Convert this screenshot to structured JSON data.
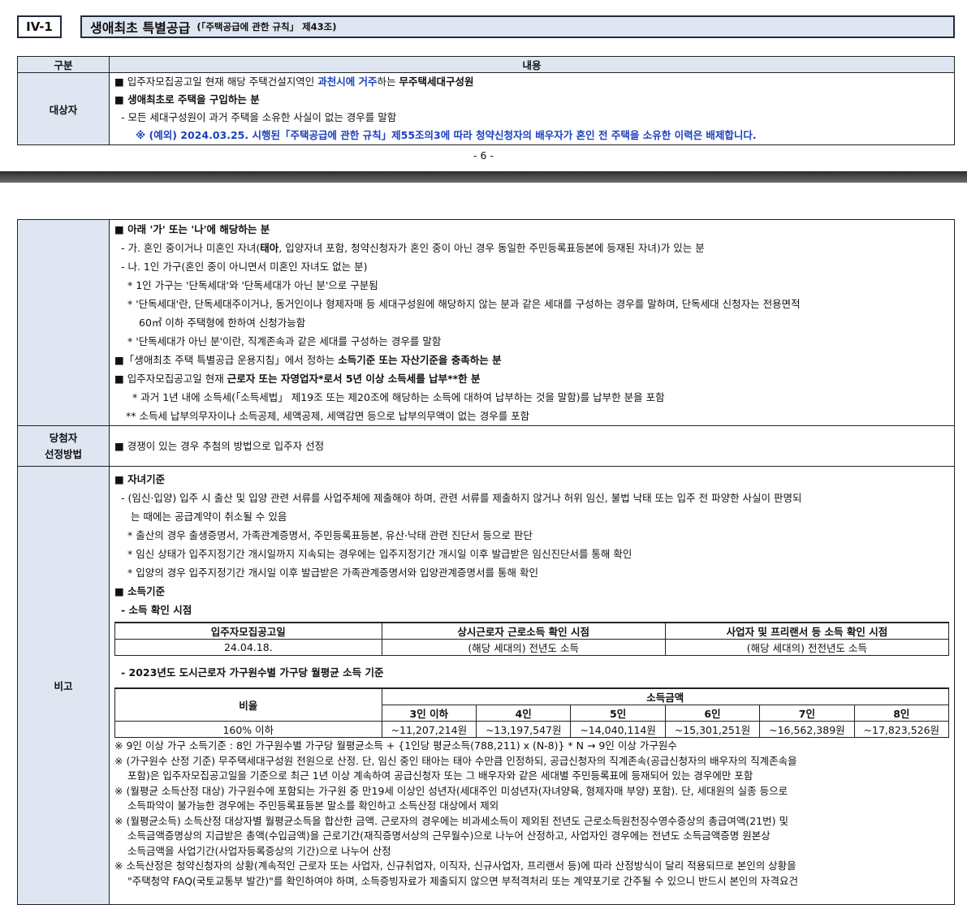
{
  "section": {
    "number": "IV-1",
    "title": "생애최초 특별공급",
    "subtitle": "(「주택공급에 관한 규칙」 제43조)"
  },
  "top_table": {
    "col_category": "구분",
    "col_content": "내용",
    "target_label": "대상자",
    "line1_a": "■ 입주자모집공고일 현재 해당 주택건설지역인 ",
    "line1_b": "과천시에 거주",
    "line1_c": "하는 ",
    "line1_d": "무주택세대구성원",
    "line2": "■ 생애최초로 주택을 구입하는 분",
    "line3": "- 모든 세대구성원이 과거 주택을 소유한 사실이 없는 경우를 말함",
    "line4": "※ (예외) 2024.03.25. 시행된「주택공급에 관한 규칙」제55조의3에 따라 청약신청자의 배우자가 혼인 전 주택을 소유한 이력은 배제합니다."
  },
  "page_number_6": "- 6 -",
  "cont": {
    "b1": "■ 아래 '가' 또는 '나'에 해당하는 분",
    "b1_ga_a": "- 가. 혼인 중이거나 미혼인 자녀(",
    "b1_ga_b": "태아",
    "b1_ga_c": ", 입양자녀 포함, 청약신청자가 혼인 중이 아닌 경우 동일한 주민등록표등본에 등재된 자녀)가 있는 분",
    "b1_na": "- 나. 1인 가구(혼인 중이 아니면서 미혼인 자녀도 없는 분)",
    "b1_s1": "* 1인 가구는 '단독세대'와 '단독세대가 아닌 분'으로 구분됨",
    "b1_s2": "* '단독세대'란, 단독세대주이거나, 동거인이나 형제자매 등 세대구성원에 해당하지 않는 분과 같은 세대를 구성하는 경우를 말하며, 단독세대 신청자는 전용면적",
    "b1_s2b": "60㎡ 이하 주택형에 한하여 신청가능함",
    "b1_s3": "* '단독세대가 아닌 분'이란, 직계존속과 같은 세대를 구성하는 경우를 말함",
    "b2_a": "■「생애최초 주택 특별공급 운용지침」에서 정하는 ",
    "b2_b": "소득기준 또는 자산기준을 충족하는 분",
    "b3_a": "■ 입주자모집공고일 현재 ",
    "b3_b": "근로자 또는 자영업자*로서 5년 이상 소득세를 납부**한 분",
    "b3_s1": "* 과거 1년 내에 소득세(「소득세법」 제19조 또는 제20조에 해당하는 소득에 대하여 납부하는 것을 말함)를 납부한 분을 포함",
    "b3_s2": "** 소득세 납부의무자이나 소득공제, 세액공제, 세액감면 등으로 납부의무액이 없는 경우를 포함"
  },
  "selection": {
    "label_1": "당첨자",
    "label_2": "선정방법",
    "text": "■ 경쟁이 있는 경우 추첨의 방법으로 입주자 선정"
  },
  "remarks": {
    "label": "비고",
    "h1": "■ 자녀기준",
    "r1": "- (임신·입양) 입주 시 출산 및 입양 관련 서류를 사업주체에 제출해야 하며, 관련 서류를 제출하지 않거나 허위 임신, 불법 낙태 또는 입주 전 파양한 사실이 판명되",
    "r1b": "는 때에는 공급계약이 취소될 수 있음",
    "r2": "* 출산의 경우 출생증명서, 가족관계증명서, 주민등록표등본, 유산·낙태 관련 진단서 등으로 판단",
    "r3": "* 임신 상태가 입주지정기간 개시일까지 지속되는 경우에는 입주지정기간 개시일 이후 발급받은 임신진단서를 통해 확인",
    "r4": "* 입양의 경우 입주지정기간 개시일 이후 발급받은 가족관계증명서와 입양관계증명서를 통해 확인",
    "h2": "■ 소득기준",
    "h2a": "- 소득 확인 시점",
    "t1_headers": [
      "입주자모집공고일",
      "상시근로자 근로소득 확인 시점",
      "사업자 및 프리랜서 등 소득 확인 시점"
    ],
    "t1_values": [
      "24.04.18.",
      "(해당 세대의) 전년도 소득",
      "(해당 세대의) 전전년도 소득"
    ],
    "h2b": "- 2023년도 도시근로자 가구원수별 가구당 월평균 소득 기준",
    "t2_ratio": "비율",
    "t2_income": "소득금액",
    "t2_cols": [
      "3인 이하",
      "4인",
      "5인",
      "6인",
      "7인",
      "8인"
    ],
    "t2_row_label": "160% 이하",
    "t2_values": [
      "~11,207,214원",
      "~13,197,547원",
      "~14,040,114원",
      "~15,301,251원",
      "~16,562,389원",
      "~17,823,526원"
    ],
    "n1": "※ 9인 이상 가구 소득기준 : 8인 가구원수별 가구당 월평균소득 + {1인당 평균소득(788,211) x (N-8)}      * N → 9인 이상 가구원수",
    "n2": "※ (가구원수 산정 기준) 무주택세대구성원 전원으로 산정. 단, 임신 중인 태아는 태아 수만큼 인정하되, 공급신청자의 직계존속(공급신청자의 배우자의 직계존속을",
    "n2b": "포함)은 입주자모집공고일을 기준으로 최근 1년 이상 계속하여 공급신청자 또는 그 배우자와 같은 세대별 주민등록표에 등재되어 있는 경우에만 포함",
    "n3": "※ (월평균 소득산정 대상) 가구원수에 포함되는 가구원 중 만19세 이상인 성년자(세대주인 미성년자(자녀양육, 형제자매 부양) 포함). 단, 세대원의 실종 등으로",
    "n3b": "소득파악이 불가능한 경우에는 주민등록표등본 말소를 확인하고 소득산정 대상에서 제외",
    "n4": "※ (월평균소득) 소득산정 대상자별 월평균소득을 합산한 금액. 근로자의 경우에는 비과세소득이 제외된 전년도 근로소득원천징수영수증상의 총급여액(21번) 및",
    "n4b": "소득금액증명상의 지급받은 총액(수입금액)을 근로기간(재직증명서상의 근무월수)으로 나누어 산정하고, 사업자인 경우에는 전년도 소득금액증명 원본상",
    "n4c": "소득금액을 사업기간(사업자등록증상의 기간)으로 나누어 산정",
    "n5": "※ 소득산정은 청약신청자의 상황(계속적인 근로자 또는 사업자, 신규취업자, 이직자, 신규사업자, 프리랜서 등)에 따라 산정방식이 달리 적용되므로 본인의 상황을",
    "n5b": "\"주택청약 FAQ(국토교통부 발간)\"를 확인하여야 하며, 소득증빙자료가 제출되지 않으면 부적격처리 또는 계약포기로 간주될 수 있으니 반드시 본인의 자격요건"
  }
}
